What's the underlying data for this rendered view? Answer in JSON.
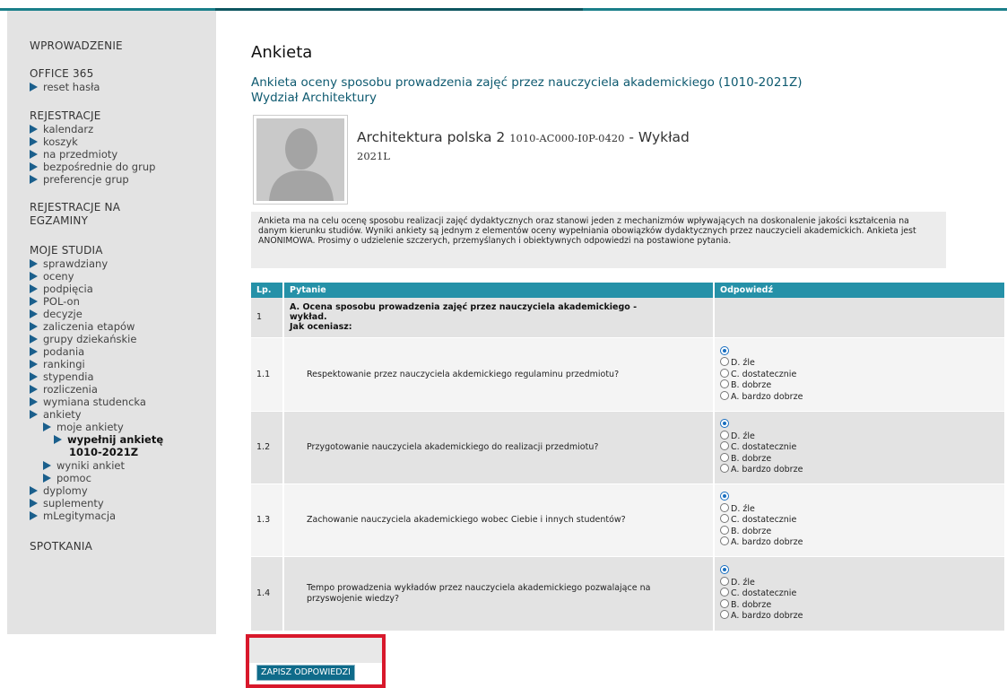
{
  "sidebar": {
    "wprowadzenie": "WPROWADZENIE",
    "office": "OFFICE 365",
    "reset": "reset hasła",
    "rejestracje": "REJESTRACJE",
    "rej_items": [
      "kalendarz",
      "koszyk",
      "na przedmioty",
      "bezpośrednie do grup",
      "preferencje grup"
    ],
    "rej_egz_1": "REJESTRACJE NA",
    "rej_egz_2": "EGZAMINY",
    "moje": "MOJE STUDIA",
    "moje_items": [
      "sprawdziany",
      "oceny",
      "podpięcia",
      "POL-on",
      "decyzje",
      "zaliczenia etapów",
      "grupy dziekańskie",
      "podania",
      "rankingi",
      "stypendia",
      "rozliczenia",
      "wymiana studencka",
      "ankiety"
    ],
    "moje_ankiety": "moje ankiety",
    "wypelnij_1": "wypełnij ankietę",
    "wypelnij_2": "1010-2021Z",
    "wyniki": "wyniki ankiet",
    "pomoc": "pomoc",
    "after_items": [
      "dyplomy",
      "suplementy",
      "mLegitymacja"
    ],
    "spotkania": "SPOTKANIA"
  },
  "main": {
    "title": "Ankieta",
    "subtitle_1": "Ankieta oceny sposobu prowadzenia zajęć przez nauczyciela akademickiego (1010-2021Z)",
    "subtitle_2": "Wydział Architektury",
    "course_name": "Architektura polska 2",
    "course_code": "1010-AC000-I0P-0420",
    "course_type": "- Wykład",
    "term": "2021L",
    "info": "Ankieta ma na celu ocenę sposobu realizacji zajęć dydaktycznych oraz stanowi jeden z mechanizmów wpływających na doskonalenie jakości kształcenia na danym kierunku studiów. Wyniki ankiety są jednym z elementów oceny wypełniania obowiązków dydaktycznych przez nauczycieli akademickich. Ankieta jest ANONIMOWA. Prosimy o udzielenie szczerych, przemyślanych i obiektywnych odpowiedzi na postawione pytania."
  },
  "table": {
    "headers": {
      "lp": "Lp.",
      "pytanie": "Pytanie",
      "odpowiedz": "Odpowiedź"
    },
    "section": {
      "lp": "1",
      "line1": "A. Ocena sposobu prowadzenia zajęć przez nauczyciela akademickiego -",
      "line2": "wykład.",
      "line3": "Jak oceniasz:"
    },
    "options": [
      "D. źle",
      "C. dostatecznie",
      "B. dobrze",
      "A. bardzo dobrze"
    ],
    "rows": [
      {
        "lp": "1.1",
        "q": "Respektowanie przez nauczyciela akdemickiego regulaminu przedmiotu?"
      },
      {
        "lp": "1.2",
        "q": "Przygotowanie nauczyciela akademickiego do realizacji przedmiotu?"
      },
      {
        "lp": "1.3",
        "q": "Zachowanie nauczyciela akademickiego wobec Ciebie i innych studentów?"
      },
      {
        "lp": "1.4",
        "q": "Tempo prowadzenia wykładów przez nauczyciela akademickiego pozwalające na przyswojenie wiedzy?"
      }
    ]
  },
  "save_button": "ZAPISZ ODPOWIEDZI",
  "colors": {
    "accent": "#2591a8",
    "highlight_border": "#d8182b",
    "tri": "#1a5f8c"
  }
}
